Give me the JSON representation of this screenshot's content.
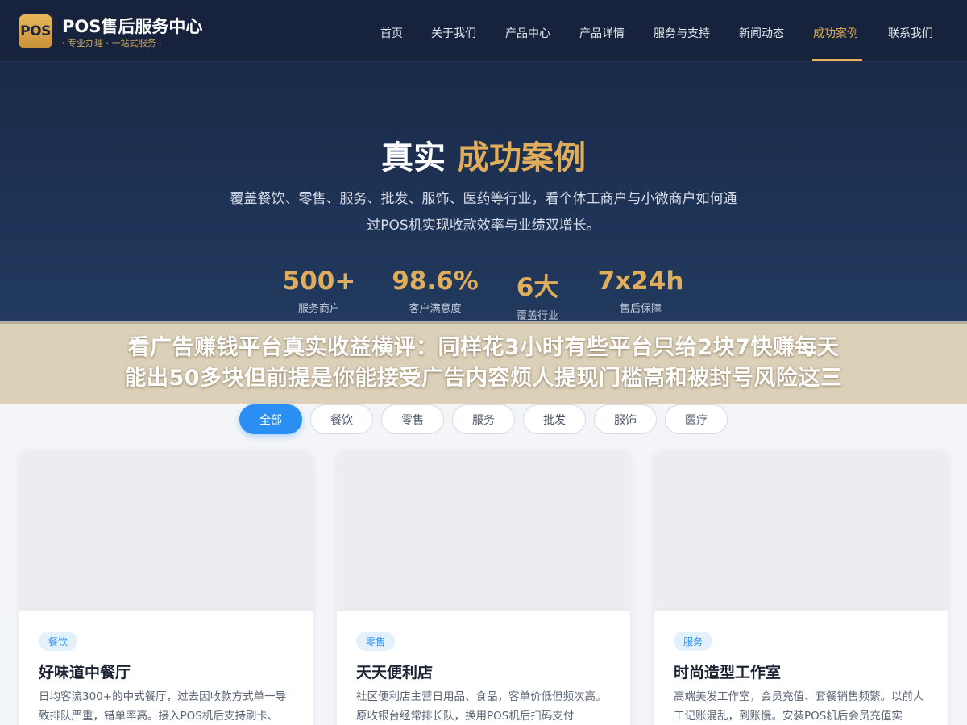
{
  "header": {
    "logo_badge": "POS",
    "logo_title": "POS售后服务中心",
    "logo_sub": "· 专业办理 · 一站式服务 ·",
    "nav": [
      "首页",
      "关于我们",
      "产品中心",
      "产品详情",
      "服务与支持",
      "新闻动态",
      "成功案例",
      "联系我们"
    ],
    "active_nav": "成功案例",
    "accent_color": "#e3b158"
  },
  "hero": {
    "title_main": "真实",
    "title_accent": "成功案例",
    "desc_line1": "覆盖餐饮、零售、服务、批发、服饰、医药等行业，看个体工商户与小微商户如何通",
    "desc_line2": "过POS机实现收款效率与业绩双增长。",
    "stats": [
      {
        "num": "500+",
        "label": "服务商户"
      },
      {
        "num": "98.6%",
        "label": "客户满意度"
      },
      {
        "num": "6大",
        "label": "覆盖行业"
      },
      {
        "num": "7x24h",
        "label": "售后保障"
      }
    ]
  },
  "banner": {
    "line1": "看广告赚钱平台真实收益横评：同样花3小时有些平台只给2块7快赚每天",
    "line2": "能出50多块但前提是你能接受广告内容烦人提现门槛高和被封号风险这三"
  },
  "filters": {
    "items": [
      "全部",
      "餐饮",
      "零售",
      "服务",
      "批发",
      "服饰",
      "医疗"
    ],
    "active": "全部",
    "active_color": "#2a8ef2"
  },
  "cards": [
    {
      "tag": "餐饮",
      "title": "好味道中餐厅",
      "desc": "日均客流300+的中式餐厅，过去因收款方式单一导致排队严重，错单率高。接入POS机后支持刷卡、"
    },
    {
      "tag": "零售",
      "title": "天天便利店",
      "desc": "社区便利店主营日用品、食品，客单价低但频次高。原收银台经常排长队，换用POS机后扫码支付"
    },
    {
      "tag": "服务",
      "title": "时尚造型工作室",
      "desc": "高端美发工作室，会员充值、套餐销售频繁。以前人工记账混乱，到账慢。安装POS机后会员充值实"
    }
  ]
}
